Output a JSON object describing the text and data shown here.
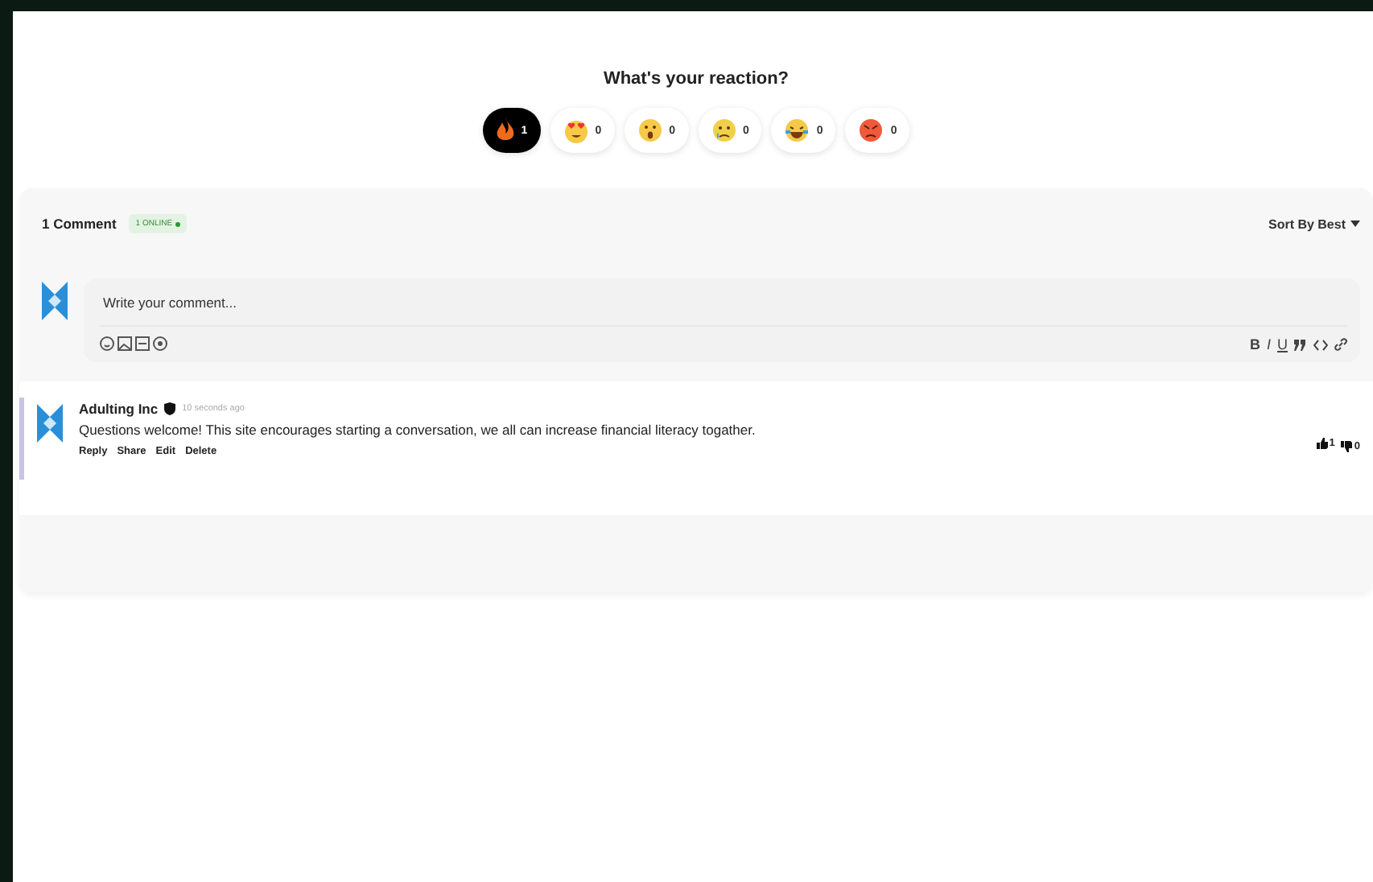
{
  "reactions": {
    "title": "What's your reaction?",
    "items": [
      {
        "kind": "fire",
        "count": "1",
        "selected": true
      },
      {
        "kind": "love",
        "count": "0",
        "selected": false
      },
      {
        "kind": "wow",
        "count": "0",
        "selected": false
      },
      {
        "kind": "sad",
        "count": "0",
        "selected": false
      },
      {
        "kind": "laugh",
        "count": "0",
        "selected": false
      },
      {
        "kind": "angry",
        "count": "0",
        "selected": false
      }
    ]
  },
  "comments_header": {
    "count": "1 Comment",
    "online": "1 ONLINE",
    "sort": "Sort By Best"
  },
  "composer": {
    "placeholder": "Write your comment...",
    "format_buttons": [
      "B",
      "I",
      "U"
    ]
  },
  "comments": [
    {
      "author": "Adulting Inc",
      "time": "10 seconds ago",
      "text": "Questions welcome! This site encourages starting a conversation, we all can increase financial literacy togather.",
      "actions": [
        "Reply",
        "Share",
        "Edit",
        "Delete"
      ],
      "upvotes": "1",
      "downvotes": "0"
    }
  ]
}
